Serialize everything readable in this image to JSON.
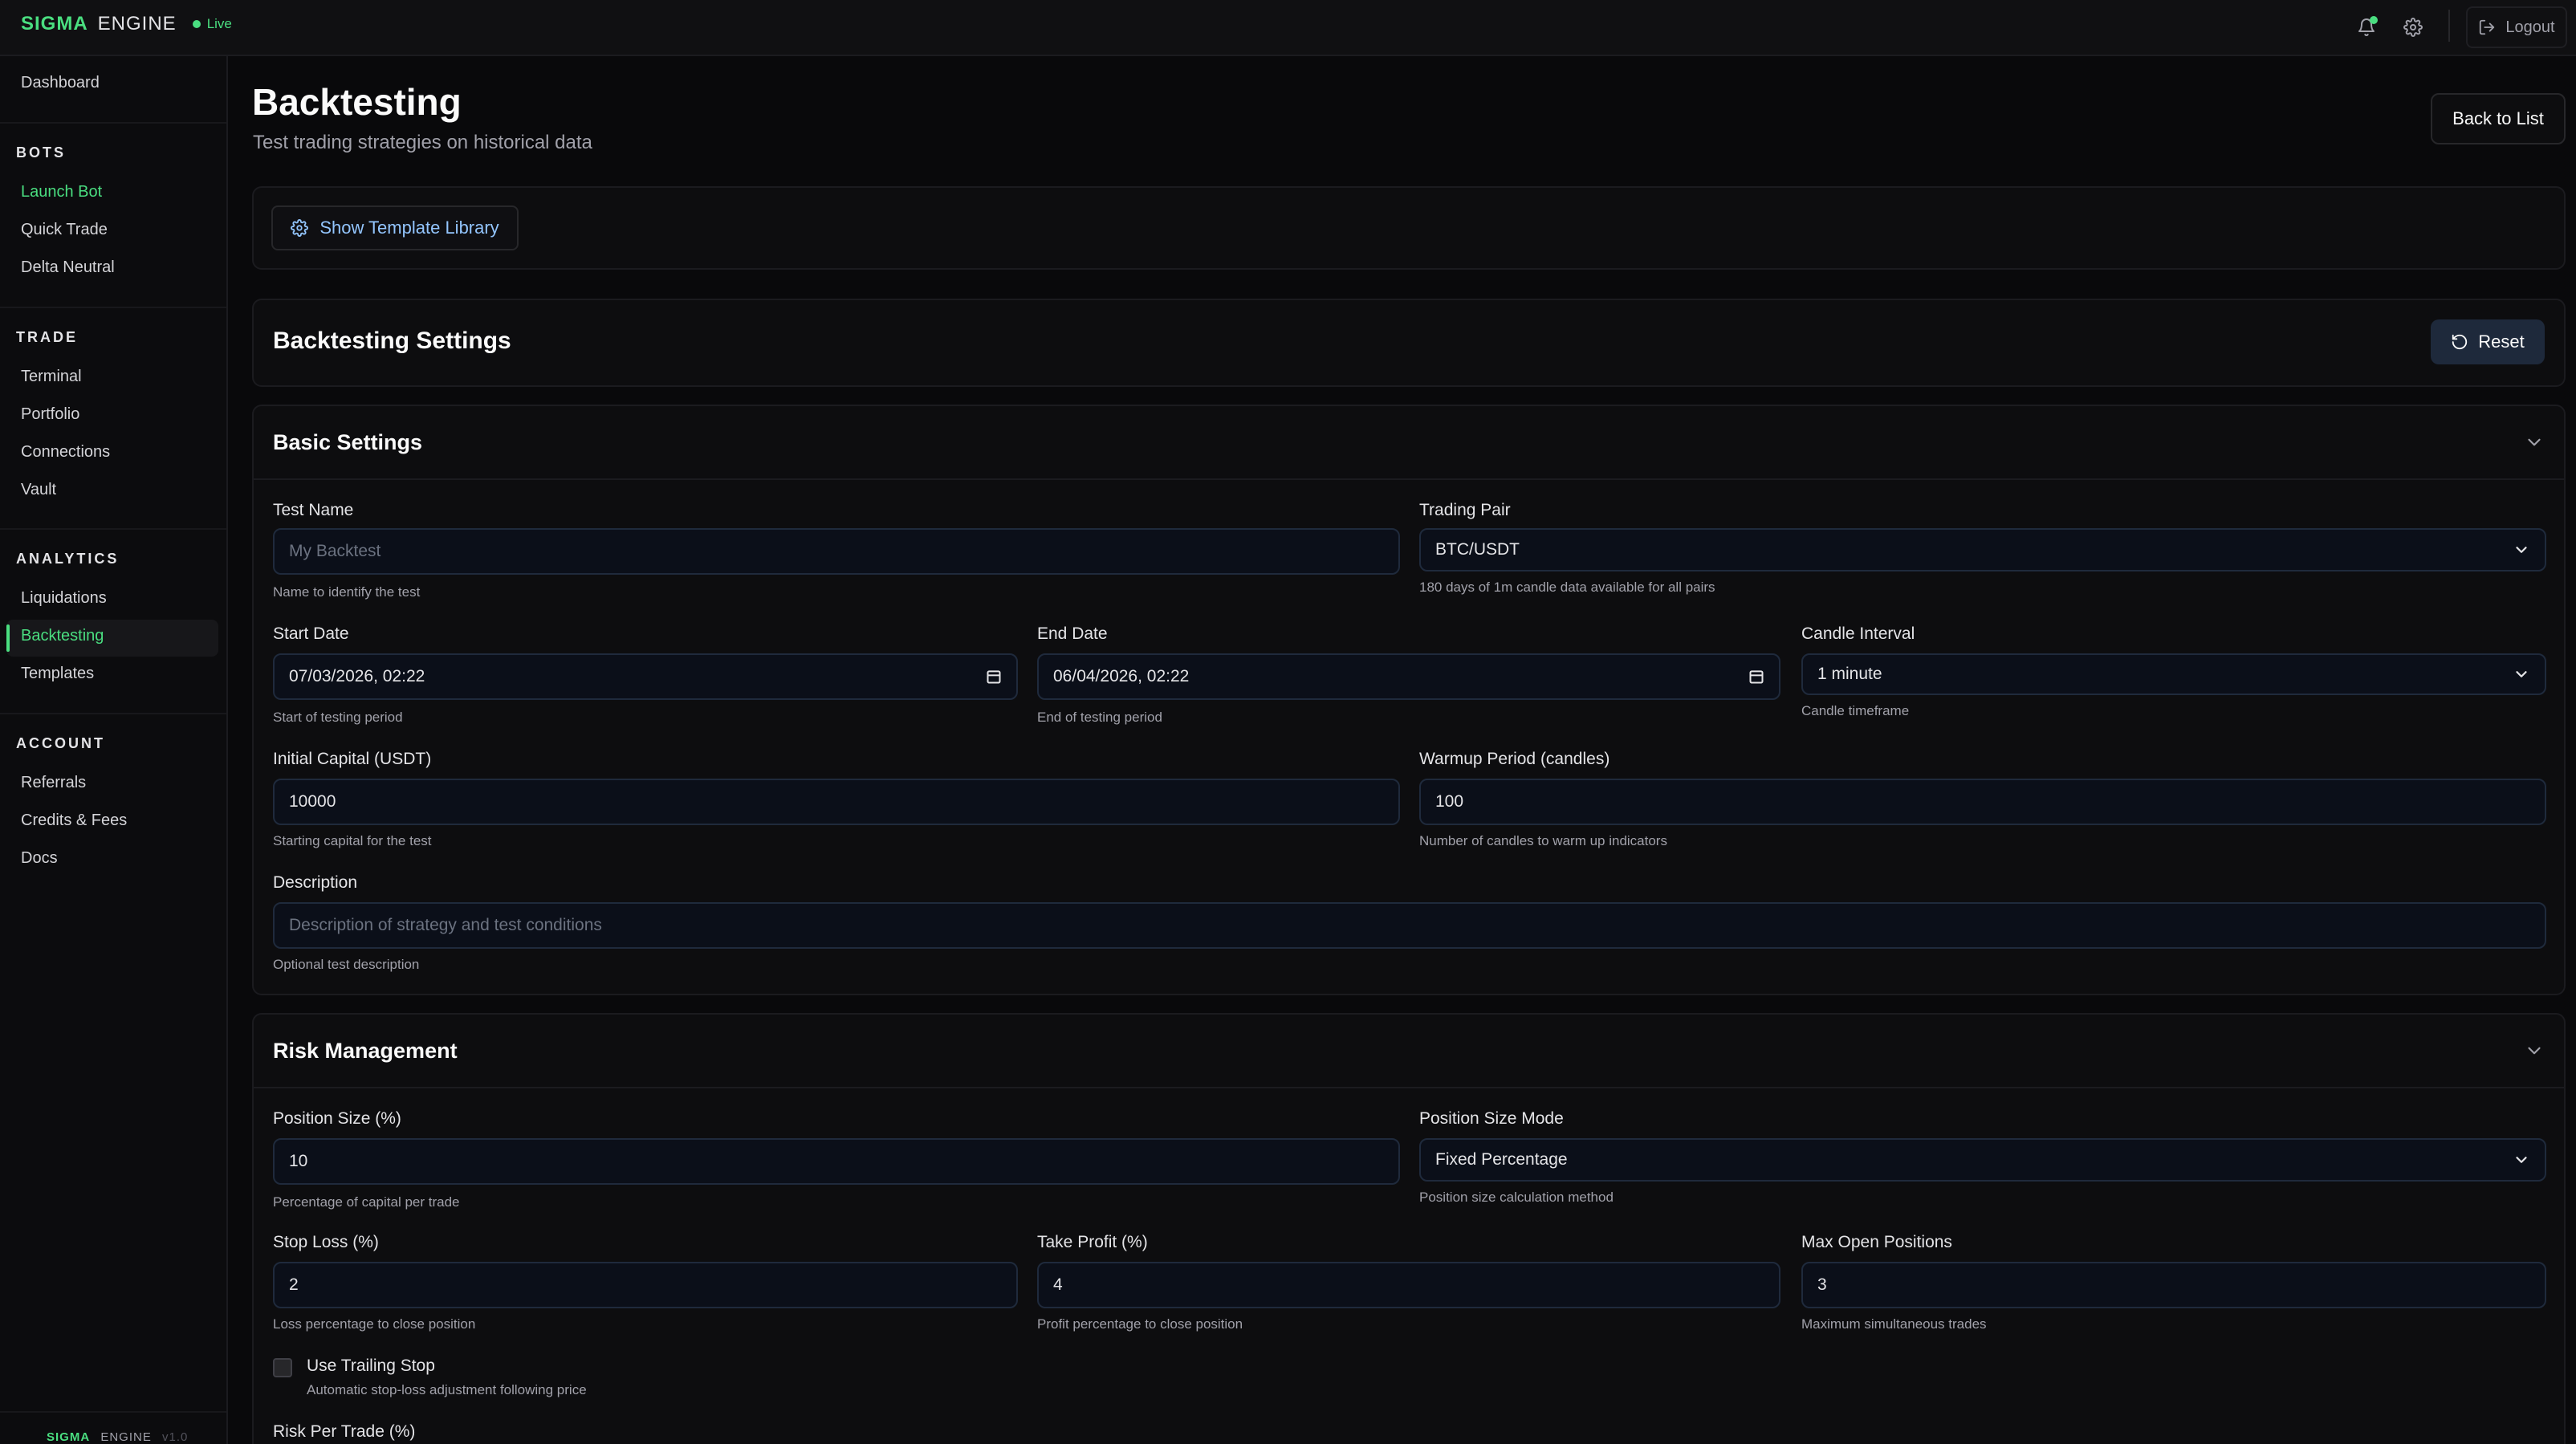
{
  "app": {
    "brand_primary": "SIGMA",
    "brand_secondary": "ENGINE",
    "status": "Live",
    "version": "v1.0",
    "accent_color": "#4ade80"
  },
  "topbar": {
    "notification_icon": "bell-icon",
    "settings_icon": "gear-icon",
    "logout_label": "Logout"
  },
  "sidebar": {
    "dashboard": "Dashboard",
    "sections": {
      "bots": "BOTS",
      "trade": "TRADE",
      "analytics": "ANALYTICS",
      "account": "ACCOUNT"
    },
    "items": {
      "launch_bot": "Launch Bot",
      "quick_trade": "Quick Trade",
      "delta_neutral": "Delta Neutral",
      "terminal": "Terminal",
      "portfolio": "Portfolio",
      "connections": "Connections",
      "vault": "Vault",
      "liquidations": "Liquidations",
      "backtesting": "Backtesting",
      "templates": "Templates",
      "referrals": "Referrals",
      "credits_fees": "Credits & Fees",
      "docs": "Docs"
    }
  },
  "page": {
    "title": "Backtesting",
    "subtitle": "Test trading strategies on historical data",
    "back_label": "Back to List",
    "template_library_label": "Show Template Library",
    "settings_title": "Backtesting Settings",
    "reset_label": "Reset"
  },
  "basic": {
    "title": "Basic Settings",
    "test_name": {
      "label": "Test Name",
      "placeholder": "My Backtest",
      "help": "Name to identify the test"
    },
    "trading_pair": {
      "label": "Trading Pair",
      "value": "BTC/USDT",
      "help": "180 days of 1m candle data available for all pairs"
    },
    "start_date": {
      "label": "Start Date",
      "value": "07/03/2026, 02:22",
      "help": "Start of testing period"
    },
    "end_date": {
      "label": "End Date",
      "value": "06/04/2026, 02:22",
      "help": "End of testing period"
    },
    "candle_interval": {
      "label": "Candle Interval",
      "value": "1 minute",
      "help": "Candle timeframe"
    },
    "initial_capital": {
      "label": "Initial Capital (USDT)",
      "value": "10000",
      "help": "Starting capital for the test"
    },
    "warmup": {
      "label": "Warmup Period (candles)",
      "value": "100",
      "help": "Number of candles to warm up indicators"
    },
    "description": {
      "label": "Description",
      "placeholder": "Description of strategy and test conditions",
      "help": "Optional test description"
    }
  },
  "risk": {
    "title": "Risk Management",
    "position_size": {
      "label": "Position Size (%)",
      "value": "10",
      "help": "Percentage of capital per trade"
    },
    "position_mode": {
      "label": "Position Size Mode",
      "value": "Fixed Percentage",
      "help": "Position size calculation method"
    },
    "stop_loss": {
      "label": "Stop Loss (%)",
      "value": "2",
      "help": "Loss percentage to close position"
    },
    "take_profit": {
      "label": "Take Profit (%)",
      "value": "4",
      "help": "Profit percentage to close position"
    },
    "max_positions": {
      "label": "Max Open Positions",
      "value": "3",
      "help": "Maximum simultaneous trades"
    },
    "trailing_stop": {
      "label": "Use Trailing Stop",
      "help": "Automatic stop-loss adjustment following price",
      "checked": false
    },
    "risk_per_trade": {
      "label": "Risk Per Trade (%)"
    }
  }
}
